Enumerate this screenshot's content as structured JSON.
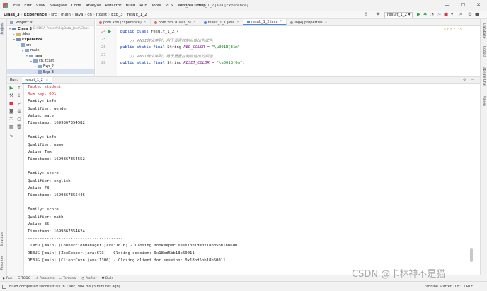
{
  "window": {
    "title": "Class_3 - result_1_2.java [Experence]",
    "menu": [
      "File",
      "Edit",
      "View",
      "Navigate",
      "Code",
      "Analyze",
      "Refactor",
      "Build",
      "Run",
      "Tools",
      "VCS",
      "Window",
      "Help"
    ],
    "controls": {
      "minimize": "—",
      "maximize": "☐",
      "close": "✕"
    }
  },
  "breadcrumbs": [
    "Class_3",
    "Experence",
    "src",
    "main",
    "java",
    "cn",
    "Itcast",
    "Exp_3",
    "result_1_2"
  ],
  "run_config": "result_1_2",
  "project_panel": {
    "title": "Project",
    "tree": [
      {
        "name": "Class 3",
        "path": "D:\\IDEA Project\\BigData_Java\\Class",
        "depth": 0,
        "open": true,
        "bold": true
      },
      {
        "name": ".idea",
        "depth": 1,
        "open": false
      },
      {
        "name": "Experence",
        "depth": 1,
        "open": true,
        "bold": true
      },
      {
        "name": "src",
        "depth": 2,
        "open": true
      },
      {
        "name": "main",
        "depth": 3,
        "open": true
      },
      {
        "name": "java",
        "depth": 4,
        "open": true
      },
      {
        "name": "cn.itcast",
        "depth": 5,
        "open": true
      },
      {
        "name": "Exp_2",
        "depth": 6,
        "open": false
      },
      {
        "name": "Exp_3",
        "depth": 6,
        "open": true,
        "selected": true
      }
    ]
  },
  "editor_tabs": [
    {
      "label": "pom.xml (Experence)",
      "color": "#e06c75",
      "active": false
    },
    {
      "label": "pom.xml (Class_3)",
      "color": "#e06c75",
      "active": false
    },
    {
      "label": "result_1_1.java",
      "color": "#4a86e8",
      "active": false
    },
    {
      "label": "result_1_2.java",
      "color": "#4a86e8",
      "active": true
    },
    {
      "label": "log4j.properties",
      "color": "#9e9e9e",
      "active": false
    }
  ],
  "editor": {
    "line_numbers": [
      "24",
      "25",
      "26",
      "27",
      "28"
    ],
    "lines": [
      {
        "kw": "public class ",
        "rest": "result_1_2 {"
      },
      {
        "comment": "// ANSI转义序列，用于设置控制台输出为红色"
      },
      {
        "kw": "public static final ",
        "type": "String ",
        "field": "RED_COLOR",
        "eq": " = ",
        "str": "\"\\u001B[31m\"",
        "end": ";"
      },
      {
        "comment": "// ANSI转义序列，用于重置控制台输出的颜色"
      },
      {
        "kw": "public static final ",
        "type": "String ",
        "field": "RESET_COLOR",
        "eq": " = ",
        "str": "\"\\u001B[0m\"",
        "end": ";"
      }
    ],
    "inspections": "⚠2  ⚠2  ^  v"
  },
  "run_panel": {
    "label": "Run:",
    "tab": "result_1_2",
    "output": [
      {
        "text": "Table: student",
        "red": true
      },
      {
        "text": "Row key: 001",
        "red": true
      },
      {
        "text": "Family: info"
      },
      {
        "text": "Qualifier: gender"
      },
      {
        "text": "Value: male"
      },
      {
        "text": "Timestamp: 1699867354582"
      },
      {
        "text": "----------------------------------------"
      },
      {
        "text": "Family: info"
      },
      {
        "text": "Qualifier: name"
      },
      {
        "text": "Value: Tom"
      },
      {
        "text": "Timestamp: 1699867354552"
      },
      {
        "text": "----------------------------------------"
      },
      {
        "text": "Family: score"
      },
      {
        "text": "Qualifier: english"
      },
      {
        "text": "Value: 78"
      },
      {
        "text": "Timestamp: 1699867355446"
      },
      {
        "text": "----------------------------------------"
      },
      {
        "text": "Family: score"
      },
      {
        "text": "Qualifier: math"
      },
      {
        "text": "Value: 85"
      },
      {
        "text": "Timestamp: 1699867354624"
      },
      {
        "text": "----------------------------------------"
      },
      {
        "text": " INFO [main] (ConnectionManager.java:1676) - Closing zookeeper sessionid=0x18bd5bb18b60011"
      },
      {
        "text": "DEBUG [main] (ZooKeeper.java:673) - Closing session: 0x18bd5bb18b60011"
      },
      {
        "text": "DEBUG [main] (ClientCnxn.java:1306) - Closing client for session: 0x18bd5bb18b60011"
      }
    ]
  },
  "left_strip": [
    "Project",
    "Structure",
    "Favorites"
  ],
  "right_strip": [
    "Database",
    "Codota",
    "Tabnine Chat",
    "Maven"
  ],
  "bottom_tools": [
    "Run",
    "TODO",
    "Problems",
    "Terminal",
    "Profiler",
    "Build"
  ],
  "status": {
    "message": "Build completed successfully in 1 sec, 904 ms (3 minutes ago)",
    "right": "tabnine Starter   108:1   CRLF"
  },
  "watermark": "CSDN @卡林神不是猫"
}
